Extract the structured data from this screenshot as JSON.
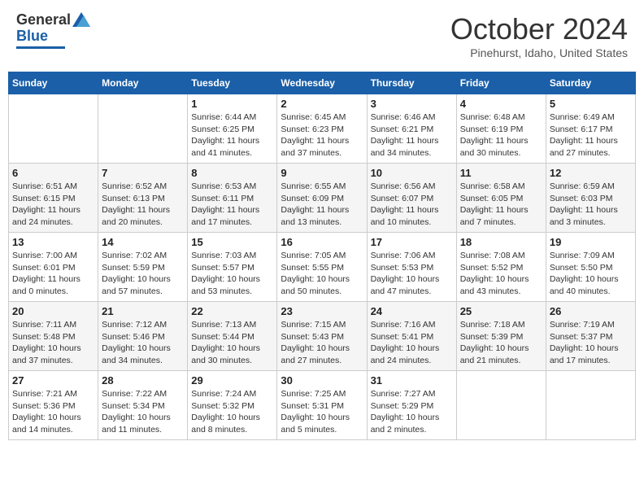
{
  "header": {
    "logo_line1": "General",
    "logo_line2": "Blue",
    "month": "October 2024",
    "location": "Pinehurst, Idaho, United States"
  },
  "weekdays": [
    "Sunday",
    "Monday",
    "Tuesday",
    "Wednesday",
    "Thursday",
    "Friday",
    "Saturday"
  ],
  "weeks": [
    [
      {
        "day": "",
        "info": ""
      },
      {
        "day": "",
        "info": ""
      },
      {
        "day": "1",
        "info": "Sunrise: 6:44 AM\nSunset: 6:25 PM\nDaylight: 11 hours\nand 41 minutes."
      },
      {
        "day": "2",
        "info": "Sunrise: 6:45 AM\nSunset: 6:23 PM\nDaylight: 11 hours\nand 37 minutes."
      },
      {
        "day": "3",
        "info": "Sunrise: 6:46 AM\nSunset: 6:21 PM\nDaylight: 11 hours\nand 34 minutes."
      },
      {
        "day": "4",
        "info": "Sunrise: 6:48 AM\nSunset: 6:19 PM\nDaylight: 11 hours\nand 30 minutes."
      },
      {
        "day": "5",
        "info": "Sunrise: 6:49 AM\nSunset: 6:17 PM\nDaylight: 11 hours\nand 27 minutes."
      }
    ],
    [
      {
        "day": "6",
        "info": "Sunrise: 6:51 AM\nSunset: 6:15 PM\nDaylight: 11 hours\nand 24 minutes."
      },
      {
        "day": "7",
        "info": "Sunrise: 6:52 AM\nSunset: 6:13 PM\nDaylight: 11 hours\nand 20 minutes."
      },
      {
        "day": "8",
        "info": "Sunrise: 6:53 AM\nSunset: 6:11 PM\nDaylight: 11 hours\nand 17 minutes."
      },
      {
        "day": "9",
        "info": "Sunrise: 6:55 AM\nSunset: 6:09 PM\nDaylight: 11 hours\nand 13 minutes."
      },
      {
        "day": "10",
        "info": "Sunrise: 6:56 AM\nSunset: 6:07 PM\nDaylight: 11 hours\nand 10 minutes."
      },
      {
        "day": "11",
        "info": "Sunrise: 6:58 AM\nSunset: 6:05 PM\nDaylight: 11 hours\nand 7 minutes."
      },
      {
        "day": "12",
        "info": "Sunrise: 6:59 AM\nSunset: 6:03 PM\nDaylight: 11 hours\nand 3 minutes."
      }
    ],
    [
      {
        "day": "13",
        "info": "Sunrise: 7:00 AM\nSunset: 6:01 PM\nDaylight: 11 hours\nand 0 minutes."
      },
      {
        "day": "14",
        "info": "Sunrise: 7:02 AM\nSunset: 5:59 PM\nDaylight: 10 hours\nand 57 minutes."
      },
      {
        "day": "15",
        "info": "Sunrise: 7:03 AM\nSunset: 5:57 PM\nDaylight: 10 hours\nand 53 minutes."
      },
      {
        "day": "16",
        "info": "Sunrise: 7:05 AM\nSunset: 5:55 PM\nDaylight: 10 hours\nand 50 minutes."
      },
      {
        "day": "17",
        "info": "Sunrise: 7:06 AM\nSunset: 5:53 PM\nDaylight: 10 hours\nand 47 minutes."
      },
      {
        "day": "18",
        "info": "Sunrise: 7:08 AM\nSunset: 5:52 PM\nDaylight: 10 hours\nand 43 minutes."
      },
      {
        "day": "19",
        "info": "Sunrise: 7:09 AM\nSunset: 5:50 PM\nDaylight: 10 hours\nand 40 minutes."
      }
    ],
    [
      {
        "day": "20",
        "info": "Sunrise: 7:11 AM\nSunset: 5:48 PM\nDaylight: 10 hours\nand 37 minutes."
      },
      {
        "day": "21",
        "info": "Sunrise: 7:12 AM\nSunset: 5:46 PM\nDaylight: 10 hours\nand 34 minutes."
      },
      {
        "day": "22",
        "info": "Sunrise: 7:13 AM\nSunset: 5:44 PM\nDaylight: 10 hours\nand 30 minutes."
      },
      {
        "day": "23",
        "info": "Sunrise: 7:15 AM\nSunset: 5:43 PM\nDaylight: 10 hours\nand 27 minutes."
      },
      {
        "day": "24",
        "info": "Sunrise: 7:16 AM\nSunset: 5:41 PM\nDaylight: 10 hours\nand 24 minutes."
      },
      {
        "day": "25",
        "info": "Sunrise: 7:18 AM\nSunset: 5:39 PM\nDaylight: 10 hours\nand 21 minutes."
      },
      {
        "day": "26",
        "info": "Sunrise: 7:19 AM\nSunset: 5:37 PM\nDaylight: 10 hours\nand 17 minutes."
      }
    ],
    [
      {
        "day": "27",
        "info": "Sunrise: 7:21 AM\nSunset: 5:36 PM\nDaylight: 10 hours\nand 14 minutes."
      },
      {
        "day": "28",
        "info": "Sunrise: 7:22 AM\nSunset: 5:34 PM\nDaylight: 10 hours\nand 11 minutes."
      },
      {
        "day": "29",
        "info": "Sunrise: 7:24 AM\nSunset: 5:32 PM\nDaylight: 10 hours\nand 8 minutes."
      },
      {
        "day": "30",
        "info": "Sunrise: 7:25 AM\nSunset: 5:31 PM\nDaylight: 10 hours\nand 5 minutes."
      },
      {
        "day": "31",
        "info": "Sunrise: 7:27 AM\nSunset: 5:29 PM\nDaylight: 10 hours\nand 2 minutes."
      },
      {
        "day": "",
        "info": ""
      },
      {
        "day": "",
        "info": ""
      }
    ]
  ]
}
